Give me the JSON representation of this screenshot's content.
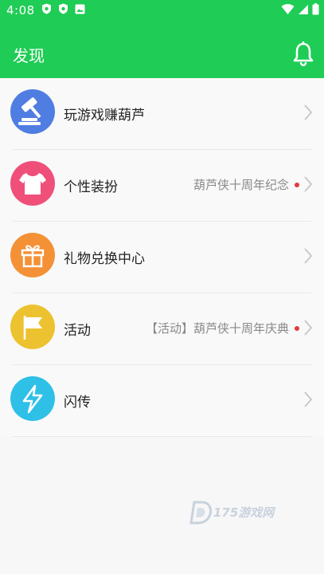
{
  "status_bar": {
    "time": "4:08",
    "left_icons": [
      "shield-icon",
      "shield-icon",
      "image-icon"
    ],
    "right_icons": [
      "wifi-icon",
      "signal-icon",
      "battery-icon"
    ]
  },
  "header": {
    "title": "发现",
    "background": "#1fcc55",
    "bell_icon": "bell-icon"
  },
  "items": [
    {
      "label": "玩游戏赚葫芦",
      "tag": "",
      "badge": false,
      "icon": "gavel-icon",
      "color": "#4f7de2"
    },
    {
      "label": "个性装扮",
      "tag": "葫芦侠十周年纪念",
      "badge": true,
      "icon": "shirt-icon",
      "color": "#ef4f79"
    },
    {
      "label": "礼物兑换中心",
      "tag": "",
      "badge": false,
      "icon": "gift-icon",
      "color": "#f49136"
    },
    {
      "label": "活动",
      "tag": "【活动】葫芦侠十周年庆典",
      "badge": true,
      "icon": "flag-icon",
      "color": "#edc230"
    },
    {
      "label": "闪传",
      "tag": "",
      "badge": false,
      "icon": "lightning-icon",
      "color": "#2fc0e8"
    }
  ],
  "watermark": {
    "text": "175游戏网",
    "icon": "watermark-logo-icon"
  }
}
